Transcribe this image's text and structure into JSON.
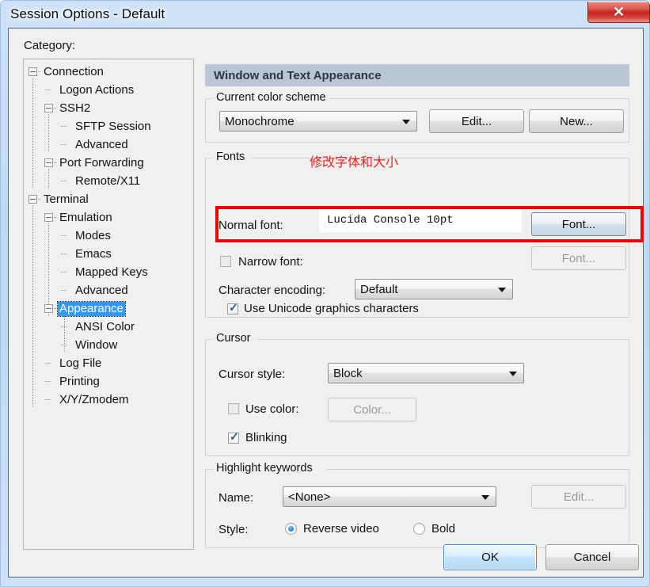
{
  "window": {
    "title": "Session Options - Default",
    "close_label": "✕"
  },
  "sidebar": {
    "label": "Category:",
    "items": [
      {
        "label": "Connection",
        "depth": 0,
        "expander": true,
        "selected": false
      },
      {
        "label": "Logon Actions",
        "depth": 1,
        "expander": false,
        "selected": false
      },
      {
        "label": "SSH2",
        "depth": 1,
        "expander": true,
        "selected": false
      },
      {
        "label": "SFTP Session",
        "depth": 2,
        "expander": false,
        "selected": false
      },
      {
        "label": "Advanced",
        "depth": 2,
        "expander": false,
        "selected": false
      },
      {
        "label": "Port Forwarding",
        "depth": 1,
        "expander": true,
        "selected": false
      },
      {
        "label": "Remote/X11",
        "depth": 2,
        "expander": false,
        "selected": false
      },
      {
        "label": "Terminal",
        "depth": 0,
        "expander": true,
        "selected": false
      },
      {
        "label": "Emulation",
        "depth": 1,
        "expander": true,
        "selected": false
      },
      {
        "label": "Modes",
        "depth": 2,
        "expander": false,
        "selected": false
      },
      {
        "label": "Emacs",
        "depth": 2,
        "expander": false,
        "selected": false
      },
      {
        "label": "Mapped Keys",
        "depth": 2,
        "expander": false,
        "selected": false
      },
      {
        "label": "Advanced",
        "depth": 2,
        "expander": false,
        "selected": false
      },
      {
        "label": "Appearance",
        "depth": 1,
        "expander": true,
        "selected": true
      },
      {
        "label": "ANSI Color",
        "depth": 2,
        "expander": false,
        "selected": false
      },
      {
        "label": "Window",
        "depth": 2,
        "expander": false,
        "selected": false
      },
      {
        "label": "Log File",
        "depth": 1,
        "expander": false,
        "selected": false
      },
      {
        "label": "Printing",
        "depth": 1,
        "expander": false,
        "selected": false
      },
      {
        "label": "X/Y/Zmodem",
        "depth": 1,
        "expander": false,
        "selected": false
      }
    ]
  },
  "panel": {
    "header": "Window and Text Appearance",
    "color_scheme": {
      "legend": "Current color scheme",
      "value": "Monochrome",
      "edit_label": "Edit...",
      "new_label": "New..."
    },
    "fonts": {
      "legend": "Fonts",
      "normal_label": "Normal font:",
      "normal_value": "Lucida Console 10pt",
      "normal_button": "Font...",
      "narrow_label": "Narrow font:",
      "narrow_button": "Font...",
      "encoding_label": "Character encoding:",
      "encoding_value": "Default",
      "unicode_label": "Use Unicode graphics characters"
    },
    "cursor": {
      "legend": "Cursor",
      "style_label": "Cursor style:",
      "style_value": "Block",
      "use_color_label": "Use color:",
      "color_button": "Color...",
      "blinking_label": "Blinking"
    },
    "highlight": {
      "legend": "Highlight keywords",
      "name_label": "Name:",
      "name_value": "<None>",
      "edit_label": "Edit...",
      "style_label": "Style:",
      "reverse_label": "Reverse video",
      "bold_label": "Bold"
    }
  },
  "annotation": {
    "text": "修改字体和大小",
    "color": "#ee2222"
  },
  "footer": {
    "ok_label": "OK",
    "cancel_label": "Cancel"
  },
  "colors": {
    "accent": "#3399ff",
    "header_bg": "#b8c6d6",
    "annotation": "#ee0000",
    "close_btn": "#c2241a"
  }
}
